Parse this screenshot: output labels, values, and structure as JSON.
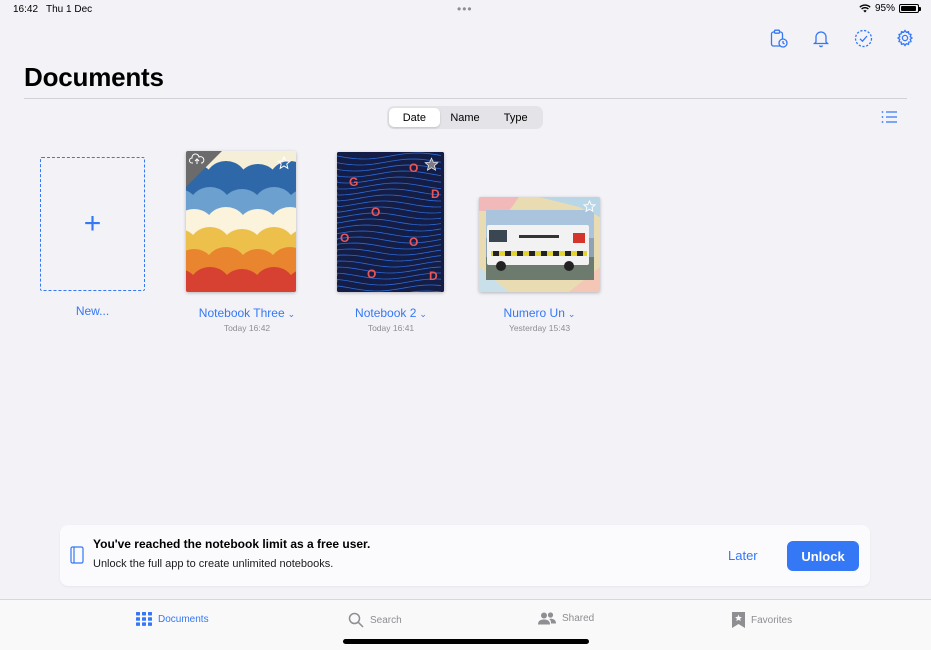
{
  "status": {
    "time": "16:42",
    "date": "Thu 1 Dec",
    "battery": "95%",
    "battery_level": 0.95
  },
  "toolbar": {
    "icons": [
      "clipboard-clock-icon",
      "bell-icon",
      "checkmark-circle-icon",
      "gear-icon"
    ]
  },
  "page": {
    "title": "Documents"
  },
  "sort": {
    "options": [
      "Date",
      "Name",
      "Type"
    ],
    "selected": "Date"
  },
  "documents": {
    "new_label": "New...",
    "items": [
      {
        "title": "Notebook Three",
        "date": "Today 16:42",
        "starred": false,
        "cloud_upload": true
      },
      {
        "title": "Notebook 2",
        "date": "Today 16:41",
        "starred": true,
        "cloud_upload": false
      },
      {
        "title": "Numero Un",
        "date": "Yesterday 15:43",
        "starred": false,
        "cloud_upload": false
      }
    ]
  },
  "banner": {
    "title": "You've reached the notebook limit as a free user.",
    "subtitle": "Unlock the full app to create unlimited notebooks.",
    "later_label": "Later",
    "unlock_label": "Unlock"
  },
  "tabs": [
    {
      "label": "Documents",
      "icon": "grid-icon",
      "active": true
    },
    {
      "label": "Search",
      "icon": "magnifier-icon",
      "active": false
    },
    {
      "label": "Shared",
      "icon": "people-icon",
      "active": false
    },
    {
      "label": "Favorites",
      "icon": "bookmark-star-icon",
      "active": false
    }
  ],
  "colors": {
    "accent": "#3478f6",
    "background": "#f2f2f7"
  }
}
